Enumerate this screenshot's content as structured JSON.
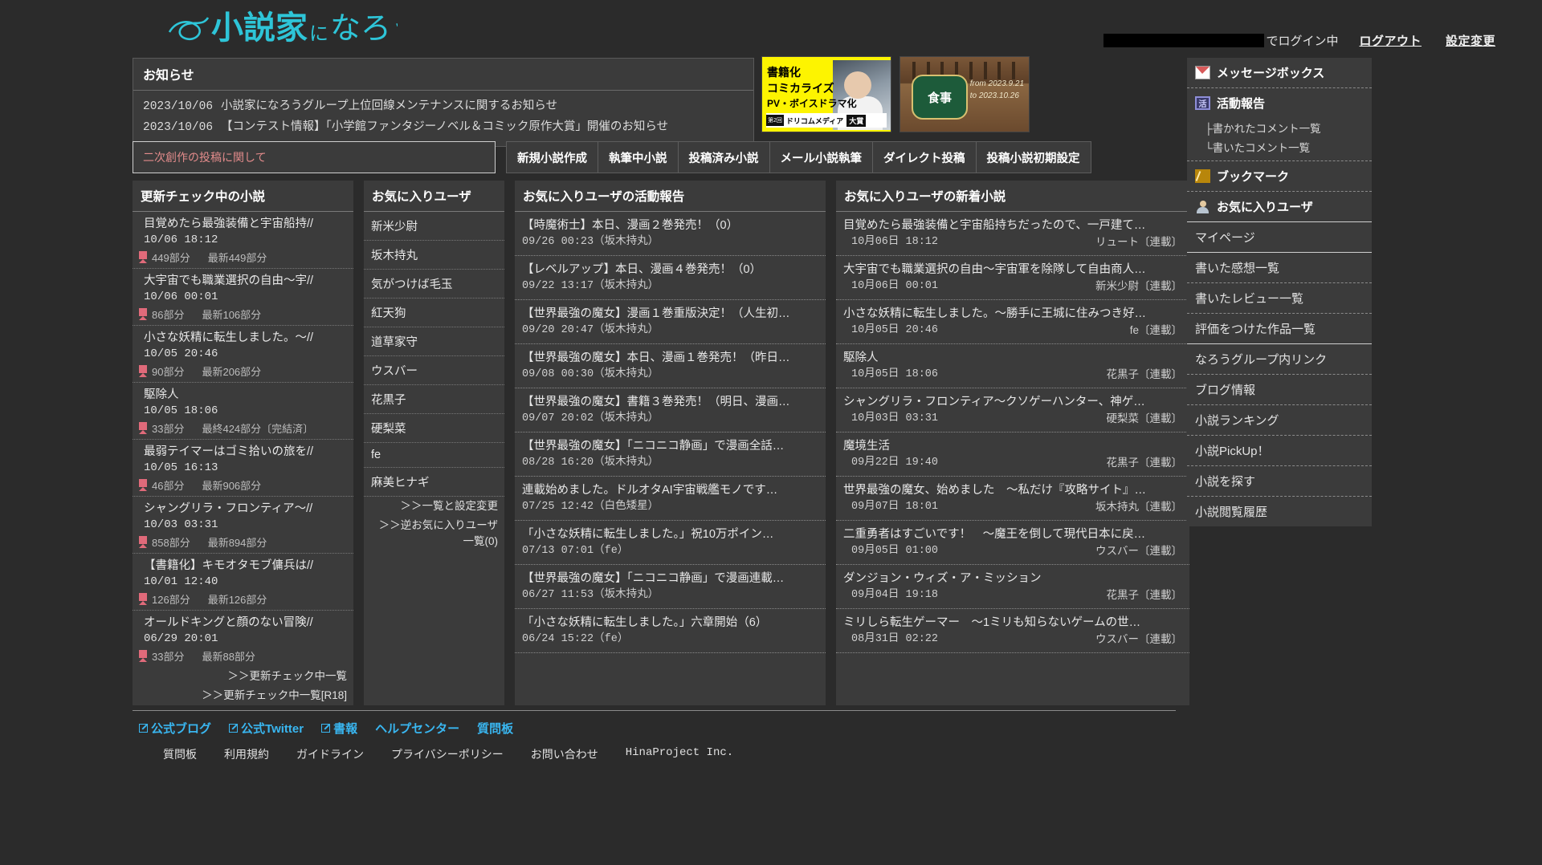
{
  "site": {
    "logo_text": "小説家になろう",
    "logo_color": "#2ec5d8"
  },
  "login": {
    "redacted_user": "",
    "status_suffix": "でログイン中",
    "logout": "ログアウト",
    "settings": "設定変更"
  },
  "notice": {
    "heading": "お知らせ",
    "rows": [
      {
        "date": "2023/10/06",
        "text": "小説家になろうグループ上位回線メンテナンスに関するお知らせ"
      },
      {
        "date": "2023/10/06",
        "text": "【コンテスト情報】「小学館ファンタジーノベル＆コミック原作大賞」開催のお知らせ"
      }
    ]
  },
  "banners": [
    {
      "l1": "書籍化",
      "l2": "コミカライズ",
      "l3": "PV・ボイスドラマ化",
      "badge": "第2回",
      "brand": "ドリコムメディア",
      "prize": "大賞"
    },
    {
      "sign": "食事",
      "date_from": "from 2023.9.21",
      "date_to": "to 2023.10.26"
    }
  ],
  "warning": {
    "text": "二次創作の投稿に関して"
  },
  "tabs": [
    {
      "label": "新規小説作成"
    },
    {
      "label": "執筆中小説"
    },
    {
      "label": "投稿済み小説"
    },
    {
      "label": "メール小説執筆"
    },
    {
      "label": "ダイレクト投稿"
    },
    {
      "label": "投稿小説初期設定"
    }
  ],
  "update_check": {
    "heading": "更新チェック中の小説",
    "items": [
      {
        "title": "目覚めたら最強装備と宇宙船持//",
        "datetime": "10/06 18:12",
        "read": "449部分",
        "latest": "最新449部分"
      },
      {
        "title": "大宇宙でも職業選択の自由～宇//",
        "datetime": "10/06 00:01",
        "read": "86部分",
        "latest": "最新106部分"
      },
      {
        "title": "小さな妖精に転生しました。～//",
        "datetime": "10/05 20:46",
        "read": "90部分",
        "latest": "最新206部分"
      },
      {
        "title": "駆除人",
        "datetime": "10/05 18:06",
        "read": "33部分",
        "latest": "最終424部分〔完結済〕"
      },
      {
        "title": "最弱テイマーはゴミ拾いの旅を//",
        "datetime": "10/05 16:13",
        "read": "46部分",
        "latest": "最新906部分"
      },
      {
        "title": "シャングリラ・フロンティア～//",
        "datetime": "10/03 03:31",
        "read": "858部分",
        "latest": "最新894部分"
      },
      {
        "title": "【書籍化】キモオタモブ傭兵は//",
        "datetime": "10/01 12:40",
        "read": "126部分",
        "latest": "最新126部分"
      },
      {
        "title": "オールドキングと顔のない冒険//",
        "datetime": "06/29 20:01",
        "read": "33部分",
        "latest": "最新88部分"
      }
    ],
    "links": [
      "＞＞更新チェック中一覧",
      "＞＞更新チェック中一覧[R18]"
    ]
  },
  "fav_users": {
    "heading": "お気に入りユーザ",
    "items": [
      {
        "name": "新米少尉"
      },
      {
        "name": "坂木持丸"
      },
      {
        "name": "気がつけば毛玉"
      },
      {
        "name": "紅天狗"
      },
      {
        "name": "道草家守"
      },
      {
        "name": "ウスバー"
      },
      {
        "name": "花黒子"
      },
      {
        "name": "硬梨菜"
      },
      {
        "name": "fe"
      },
      {
        "name": "麻美ヒナギ"
      }
    ],
    "links": [
      "＞＞一覧と設定変更",
      "＞＞逆お気に入りユーザ一覧(0)"
    ]
  },
  "fav_reports": {
    "heading": "お気に入りユーザの活動報告",
    "items": [
      {
        "title": "【時魔術士】本日、漫画２巻発売！（0）",
        "date": "09/26 00:23（坂木持丸）"
      },
      {
        "title": "【レベルアップ】本日、漫画４巻発売！（0）",
        "date": "09/22 13:17（坂木持丸）"
      },
      {
        "title": "【世界最強の魔女】漫画１巻重版決定！（人生初…",
        "date": "09/20 20:47（坂木持丸）"
      },
      {
        "title": "【世界最強の魔女】本日、漫画１巻発売！（昨日…",
        "date": "09/08 00:30（坂木持丸）"
      },
      {
        "title": "【世界最強の魔女】書籍３巻発売！（明日、漫画…",
        "date": "09/07 20:02（坂木持丸）"
      },
      {
        "title": "【世界最強の魔女】「ニコニコ静画」で漫画全話…",
        "date": "08/28 16:20（坂木持丸）"
      },
      {
        "title": "連載始めました。ドルオタAI宇宙戦艦モノです…",
        "date": "07/25 12:42（白色矮星）"
      },
      {
        "title": "「小さな妖精に転生しました。」祝10万ポイン…",
        "date": "07/13 07:01（fe）"
      },
      {
        "title": "【世界最強の魔女】「ニコニコ静画」で漫画連載…",
        "date": "06/27 11:53（坂木持丸）"
      },
      {
        "title": "「小さな妖精に転生しました。」六章開始（6）",
        "date": "06/24 15:22（fe）"
      }
    ]
  },
  "fav_novels": {
    "heading": "お気に入りユーザの新着小説",
    "items": [
      {
        "title": "目覚めたら最強装備と宇宙船持ちだったので、一戸建て…",
        "date": "10月06日 18:12",
        "author": "リュート〔連載〕"
      },
      {
        "title": "大宇宙でも職業選択の自由～宇宙軍を除隊して自由商人…",
        "date": "10月06日 00:01",
        "author": "新米少尉〔連載〕"
      },
      {
        "title": "小さな妖精に転生しました。～勝手に王城に住みつき好…",
        "date": "10月05日 20:46",
        "author": "fe〔連載〕"
      },
      {
        "title": "駆除人",
        "date": "10月05日 18:06",
        "author": "花黒子〔連載〕"
      },
      {
        "title": "シャングリラ・フロンティア～クソゲーハンター、神ゲ…",
        "date": "10月03日 03:31",
        "author": "硬梨菜〔連載〕"
      },
      {
        "title": "魔境生活",
        "date": "09月22日 19:40",
        "author": "花黒子〔連載〕"
      },
      {
        "title": "世界最強の魔女、始めました　～私だけ『攻略サイト』…",
        "date": "09月07日 18:01",
        "author": "坂木持丸〔連載〕"
      },
      {
        "title": "二重勇者はすごいです！　～魔王を倒して現代日本に戻…",
        "date": "09月05日 01:00",
        "author": "ウスバー〔連載〕"
      },
      {
        "title": "ダンジョン・ウィズ・ア・ミッション",
        "date": "09月04日 19:18",
        "author": "花黒子〔連載〕"
      },
      {
        "title": "ミリしら転生ゲーマー　～1ミリも知らないゲームの世…",
        "date": "08月31日 02:22",
        "author": "ウスバー〔連載〕"
      }
    ]
  },
  "sidebar": {
    "items": [
      {
        "label": "メッセージボックス",
        "icon": "mail-icon",
        "bold": true
      },
      {
        "label": "活動報告",
        "icon": "activity-icon",
        "bold": true
      },
      {
        "label": "ブックマーク",
        "icon": "bookmark-icon",
        "bold": true
      },
      {
        "label": "お気に入りユーザ",
        "icon": "user-icon",
        "bold": true
      },
      {
        "label": "マイページ"
      },
      {
        "label": "書いた感想一覧"
      },
      {
        "label": "書いたレビュー一覧"
      },
      {
        "label": "評価をつけた作品一覧"
      },
      {
        "label": "なろうグループ内リンク"
      },
      {
        "label": "ブログ情報"
      },
      {
        "label": "小説ランキング"
      },
      {
        "label": "小説PickUp！"
      },
      {
        "label": "小説を探す"
      },
      {
        "label": "小説閲覧履歴"
      }
    ],
    "activity_subs": [
      "├書かれたコメント一覧",
      "└書いたコメント一覧"
    ]
  },
  "footer": {
    "primary": [
      {
        "label": "公式ブログ",
        "external": true
      },
      {
        "label": "公式Twitter",
        "external": true
      },
      {
        "label": "書報",
        "external": true
      },
      {
        "label": "ヘルプセンター",
        "external": false
      },
      {
        "label": "質問板",
        "external": false
      }
    ],
    "secondary": [
      "質問板",
      "利用規約",
      "ガイドライン",
      "プライバシーポリシー",
      "お問い合わせ",
      "HinaProject Inc."
    ]
  }
}
